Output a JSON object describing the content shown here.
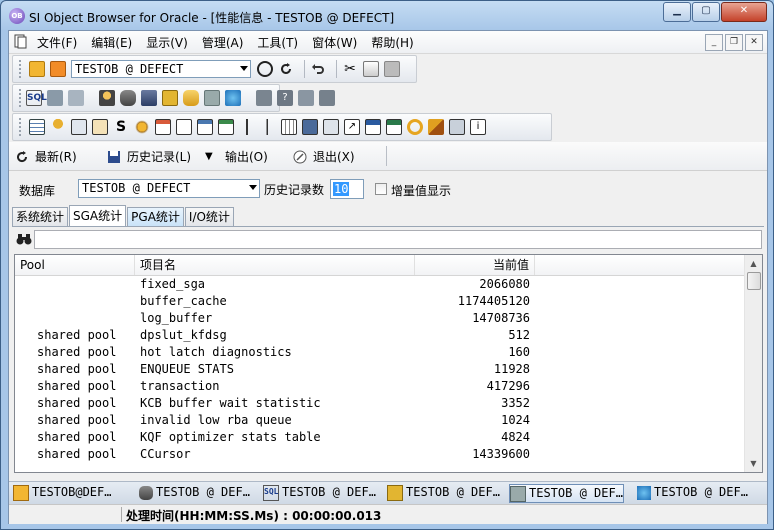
{
  "window": {
    "title": "SI Object Browser for Oracle - [性能信息 - TESTOB @ DEFECT]",
    "app_icon_label": "OB"
  },
  "menu": {
    "items": [
      "文件(F)",
      "编辑(E)",
      "显示(V)",
      "管理(A)",
      "工具(T)",
      "窗体(W)",
      "帮助(H)"
    ]
  },
  "toolbar": {
    "connection": "TESTOB @ DEFECT"
  },
  "actions": {
    "refresh": "最新(R)",
    "history": "历史记录(L)",
    "output": "输出(O)",
    "exit": "退出(X)"
  },
  "db_bar": {
    "db_label": "数据库",
    "db_value": "TESTOB @ DEFECT",
    "history_count_label": "历史记录数",
    "history_count_value": "10",
    "increment_label": "增量值显示"
  },
  "tabs": [
    "系统统计",
    "SGA统计",
    "PGA统计",
    "I/O统计"
  ],
  "grid": {
    "headers": [
      "Pool",
      "项目名",
      "当前值"
    ],
    "rows": [
      {
        "pool": "",
        "name": "fixed_sga",
        "value": "2066080"
      },
      {
        "pool": "",
        "name": "buffer_cache",
        "value": "1174405120"
      },
      {
        "pool": "",
        "name": "log_buffer",
        "value": "14708736"
      },
      {
        "pool": "shared pool",
        "name": "dpslut_kfdsg",
        "value": "512"
      },
      {
        "pool": "shared pool",
        "name": "hot latch diagnostics",
        "value": "160"
      },
      {
        "pool": "shared pool",
        "name": "ENQUEUE STATS",
        "value": "11928"
      },
      {
        "pool": "shared pool",
        "name": "transaction",
        "value": "417296"
      },
      {
        "pool": "shared pool",
        "name": "KCB buffer wait statistic",
        "value": "3352"
      },
      {
        "pool": "shared pool",
        "name": "invalid low rba queue",
        "value": "1024"
      },
      {
        "pool": "shared pool",
        "name": "KQF optimizer stats table",
        "value": "4824"
      },
      {
        "pool": "shared pool",
        "name": "CCursor",
        "value": "14339600"
      }
    ]
  },
  "taskbar": {
    "items": [
      "TESTOB@DEF…",
      "TESTOB @ DEF…",
      "TESTOB @ DEF…",
      "TESTOB @ DEF…",
      "TESTOB @ DEF…",
      "TESTOB @ DEF…"
    ]
  },
  "status": {
    "text": "处理时间(HH:MM:SS.Ms) : 00:00:00.013"
  }
}
